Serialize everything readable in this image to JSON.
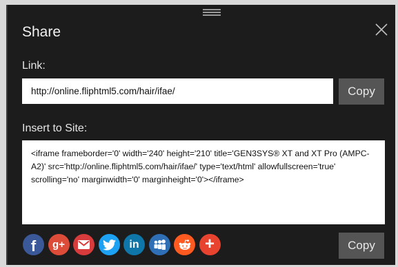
{
  "dialog": {
    "title": "Share"
  },
  "link": {
    "label": "Link:",
    "value": "http://online.fliphtml5.com/hair/ifae/",
    "copy_label": "Copy"
  },
  "insert": {
    "label": "Insert to Site:",
    "code": "<iframe frameborder='0'  width='240' height='210'  title='GEN3SYS® XT and XT Pro (AMPC-A2)' src='http://online.fliphtml5.com/hair/ifae/' type='text/html' allowfullscreen='true' scrolling='no' marginwidth='0' marginheight='0'></iframe>",
    "copy_label": "Copy"
  },
  "socials": [
    {
      "name": "facebook",
      "text": "f",
      "color": "#3b5998"
    },
    {
      "name": "google-plus",
      "text": "g+",
      "color": "#dd4b39"
    },
    {
      "name": "email",
      "text": "",
      "color": "#d73b3b"
    },
    {
      "name": "twitter",
      "text": "",
      "color": "#1da1f2"
    },
    {
      "name": "linkedin",
      "text": "in",
      "color": "#0e76a8"
    },
    {
      "name": "myspace",
      "text": "",
      "color": "#2f6fb6"
    },
    {
      "name": "reddit",
      "text": "",
      "color": "#ff5a1f"
    },
    {
      "name": "more",
      "text": "+",
      "color": "#e8432f"
    }
  ]
}
